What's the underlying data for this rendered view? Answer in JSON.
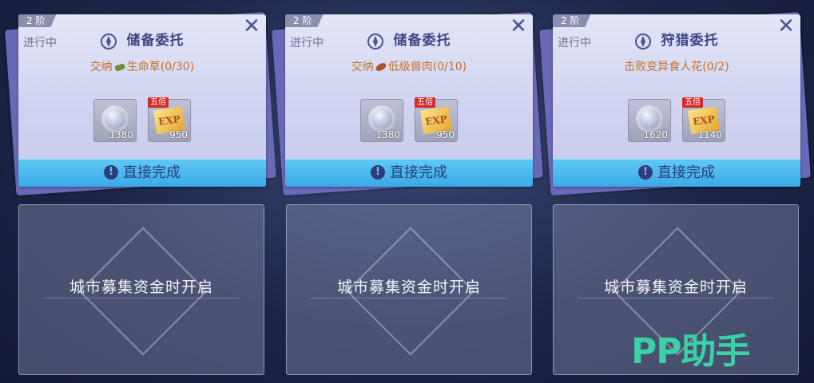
{
  "quests": [
    {
      "tier": "2 阶",
      "status": "进行中",
      "title": "储备委托",
      "objective_prefix": "交纳",
      "objective_text": "生命草(0/30)",
      "item_icon": "herb-bundle-icon",
      "rewards": [
        {
          "kind": "silver-coin-icon",
          "qty": "1380"
        },
        {
          "kind": "exp-ticket-icon",
          "label": "EXP",
          "multiplier": "五倍",
          "qty": "950"
        }
      ],
      "action": "直接完成"
    },
    {
      "tier": "2 阶",
      "status": "进行中",
      "title": "储备委托",
      "objective_prefix": "交纳",
      "objective_text": "低级兽肉(0/10)",
      "item_icon": "meat-icon",
      "rewards": [
        {
          "kind": "silver-coin-icon",
          "qty": "1380"
        },
        {
          "kind": "exp-ticket-icon",
          "label": "EXP",
          "multiplier": "五倍",
          "qty": "950"
        }
      ],
      "action": "直接完成"
    },
    {
      "tier": "2 阶",
      "status": "进行中",
      "title": "狩猎委托",
      "objective_prefix": "",
      "objective_text": "击败变异食人花(0/2)",
      "item_icon": "",
      "rewards": [
        {
          "kind": "silver-coin-icon",
          "qty": "1620"
        },
        {
          "kind": "exp-ticket-icon",
          "label": "EXP",
          "multiplier": "五倍",
          "qty": "1140"
        }
      ],
      "action": "直接完成"
    }
  ],
  "locked_slots": [
    {
      "label": "城市募集资金时开启"
    },
    {
      "label": "城市募集资金时开启"
    },
    {
      "label": "城市募集资金时开启"
    }
  ],
  "watermark": "PP助手",
  "colors": {
    "button": "#3aa9e6",
    "objective": "#c7702a",
    "watermark": "#3ad1a7"
  }
}
